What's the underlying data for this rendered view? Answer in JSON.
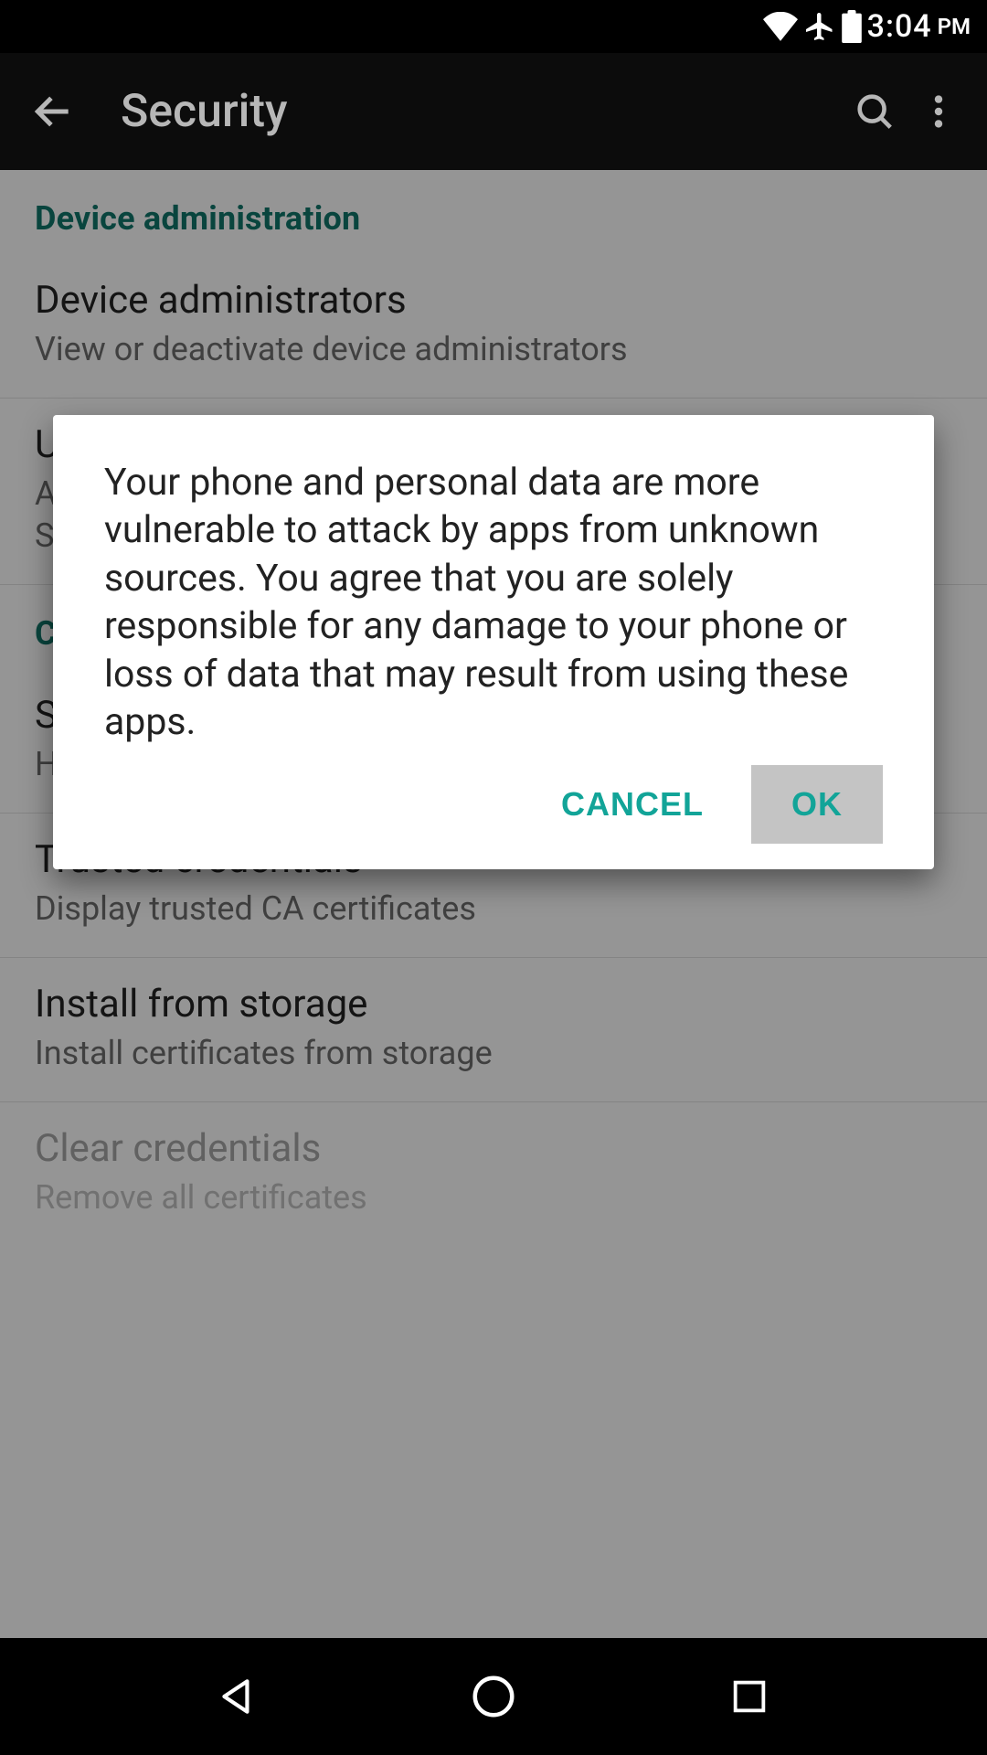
{
  "status": {
    "time": "3:04",
    "ampm": "PM"
  },
  "appbar": {
    "title": "Security"
  },
  "sections": {
    "device_admin": {
      "header": "Device administration",
      "items": {
        "device_admins": {
          "title": "Device administrators",
          "sub": "View or deactivate device administrators"
        },
        "unknown_sources": {
          "title": "Unknown sources",
          "sub": "Allow installation of apps from sources other than the Play Store"
        }
      }
    },
    "cred_storage": {
      "header": "Credential storage",
      "items": {
        "storage_type": {
          "title": "Storage type",
          "sub": "Hardware-backed"
        },
        "trusted_creds": {
          "title": "Trusted credentials",
          "sub": "Display trusted CA certificates"
        },
        "install_storage": {
          "title": "Install from storage",
          "sub": "Install certificates from storage"
        },
        "clear_creds": {
          "title": "Clear credentials",
          "sub": "Remove all certificates"
        }
      }
    }
  },
  "dialog": {
    "message": "Your phone and personal data are more vulnerable to attack by apps from unknown sources. You agree that you are solely responsible for any damage to your phone or loss of data that may result from using these apps.",
    "cancel": "CANCEL",
    "ok": "OK"
  }
}
